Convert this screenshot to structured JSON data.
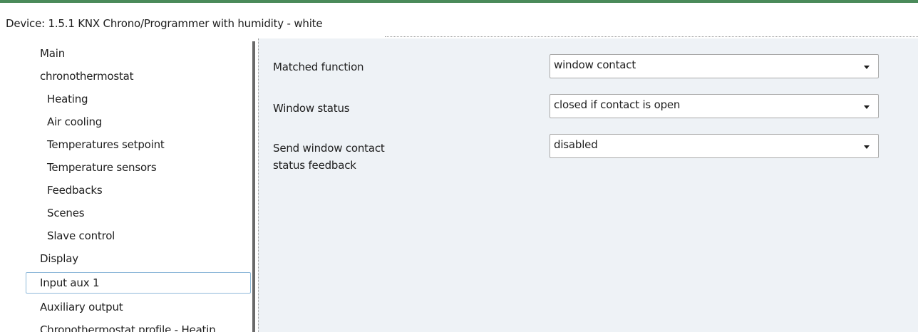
{
  "header": {
    "title": "Device: 1.5.1  KNX Chrono/Programmer with humidity - white"
  },
  "sidebar": {
    "items": [
      {
        "label": "Main",
        "level": "top"
      },
      {
        "label": "chronothermostat",
        "level": "top"
      },
      {
        "label": "Heating",
        "level": "sub"
      },
      {
        "label": "Air cooling",
        "level": "sub"
      },
      {
        "label": "Temperatures setpoint",
        "level": "sub"
      },
      {
        "label": "Temperature sensors",
        "level": "sub"
      },
      {
        "label": "Feedbacks",
        "level": "sub"
      },
      {
        "label": "Scenes",
        "level": "sub"
      },
      {
        "label": "Slave control",
        "level": "sub"
      },
      {
        "label": "Display",
        "level": "top"
      },
      {
        "label": "Input aux 1",
        "level": "top",
        "selected": true
      },
      {
        "label": "Auxiliary output",
        "level": "top"
      },
      {
        "label": "Chronothermostat profile - Heatin",
        "level": "top"
      }
    ]
  },
  "params": [
    {
      "label": "Matched function",
      "value": "window contact"
    },
    {
      "label": "Window status",
      "value": "closed if contact is open"
    },
    {
      "label": "Send window contact\nstatus feedback",
      "value": "disabled"
    }
  ],
  "colors": {
    "accent": "#4a8a5a",
    "panel_bg": "#eef2f6",
    "selection_border": "#8fb9d9"
  },
  "icons": {
    "dropdown": "chevron-down-icon"
  }
}
